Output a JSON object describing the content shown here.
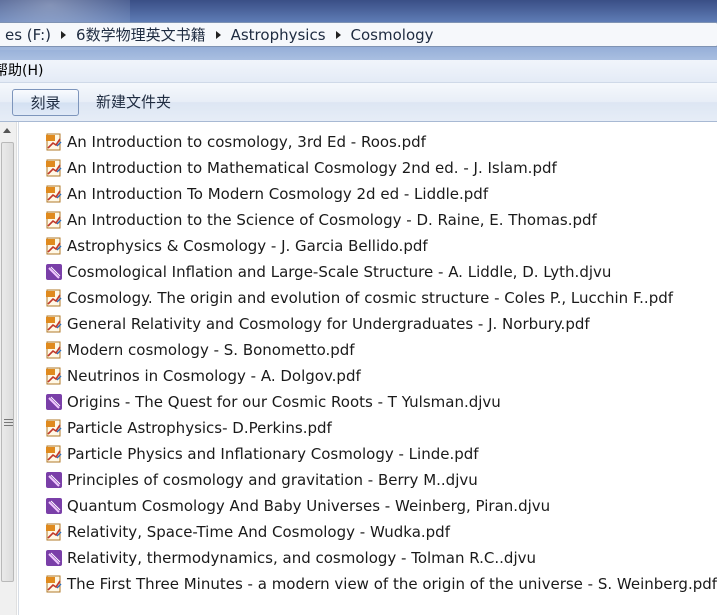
{
  "address": {
    "crumbs": [
      "es (F:)",
      "6数学物理英文书籍",
      "Astrophysics",
      "Cosmology"
    ]
  },
  "menu": {
    "help": "帮助(H)"
  },
  "toolbar": {
    "burn": "刻录",
    "new_folder": "新建文件夹"
  },
  "colors": {
    "pdf": "#e08a1e",
    "djvu": "#7a3fa8"
  },
  "files": [
    {
      "name": "An Introduction to cosmology, 3rd Ed - Roos.pdf",
      "type": "pdf"
    },
    {
      "name": "An Introduction to Mathematical Cosmology 2nd ed. - J. Islam.pdf",
      "type": "pdf"
    },
    {
      "name": "An Introduction To Modern Cosmology 2d ed - Liddle.pdf",
      "type": "pdf"
    },
    {
      "name": "An Introduction to the Science of Cosmology - D. Raine, E. Thomas.pdf",
      "type": "pdf"
    },
    {
      "name": "Astrophysics & Cosmology - J. Garcia Bellido.pdf",
      "type": "pdf"
    },
    {
      "name": "Cosmological Inflation and Large-Scale Structure - A. Liddle, D. Lyth.djvu",
      "type": "djvu"
    },
    {
      "name": "Cosmology. The origin and evolution of cosmic structure - Coles P., Lucchin F..pdf",
      "type": "pdf"
    },
    {
      "name": "General Relativity and Cosmology for Undergraduates - J. Norbury.pdf",
      "type": "pdf"
    },
    {
      "name": "Modern cosmology - S. Bonometto.pdf",
      "type": "pdf"
    },
    {
      "name": "Neutrinos in Cosmology - A. Dolgov.pdf",
      "type": "pdf"
    },
    {
      "name": "Origins - The Quest for our Cosmic Roots - T Yulsman.djvu",
      "type": "djvu"
    },
    {
      "name": "Particle Astrophysics- D.Perkins.pdf",
      "type": "pdf"
    },
    {
      "name": "Particle Physics and Inflationary Cosmology - Linde.pdf",
      "type": "pdf"
    },
    {
      "name": "Principles of cosmology and gravitation - Berry M..djvu",
      "type": "djvu"
    },
    {
      "name": "Quantum Cosmology And Baby Universes - Weinberg, Piran.djvu",
      "type": "djvu"
    },
    {
      "name": "Relativity, Space-Time And Cosmology - Wudka.pdf",
      "type": "pdf"
    },
    {
      "name": "Relativity, thermodynamics, and cosmology - Tolman R.C..djvu",
      "type": "djvu"
    },
    {
      "name": "The First Three Minutes - a modern view of the origin of the universe - S. Weinberg.pdf",
      "type": "pdf"
    }
  ]
}
